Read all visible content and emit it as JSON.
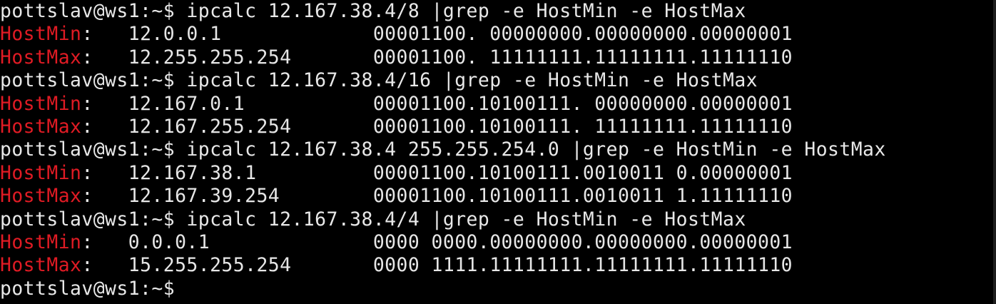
{
  "terminal": {
    "prompt": "pottslav@ws1:~$",
    "blocks": [
      {
        "command": " ipcalc 12.167.38.4/8 |grep -e HostMin -e HostMax",
        "hostmin": {
          "label": "HostMin",
          "rest": ":   12.0.0.1             00001100. 00000000.00000000.00000001"
        },
        "hostmax": {
          "label": "HostMax",
          "rest": ":   12.255.255.254       00001100. 11111111.11111111.11111110"
        }
      },
      {
        "command": " ipcalc 12.167.38.4/16 |grep -e HostMin -e HostMax",
        "hostmin": {
          "label": "HostMin",
          "rest": ":   12.167.0.1           00001100.10100111. 00000000.00000001"
        },
        "hostmax": {
          "label": "HostMax",
          "rest": ":   12.167.255.254       00001100.10100111. 11111111.11111110"
        }
      },
      {
        "command": " ipcalc 12.167.38.4 255.255.254.0 |grep -e HostMin -e HostMax",
        "hostmin": {
          "label": "HostMin",
          "rest": ":   12.167.38.1          00001100.10100111.0010011 0.00000001"
        },
        "hostmax": {
          "label": "HostMax",
          "rest": ":   12.167.39.254        00001100.10100111.0010011 1.11111110"
        }
      },
      {
        "command": " ipcalc 12.167.38.4/4 |grep -e HostMin -e HostMax",
        "hostmin": {
          "label": "HostMin",
          "rest": ":   0.0.0.1              0000 0000.00000000.00000000.00000001"
        },
        "hostmax": {
          "label": "HostMax",
          "rest": ":   15.255.255.254       0000 1111.11111111.11111111.11111110"
        }
      }
    ],
    "final_prompt": "pottslav@ws1:~$"
  },
  "colors": {
    "background": "#000000",
    "text": "#e6e6e6",
    "highlight": "#e01b24"
  }
}
